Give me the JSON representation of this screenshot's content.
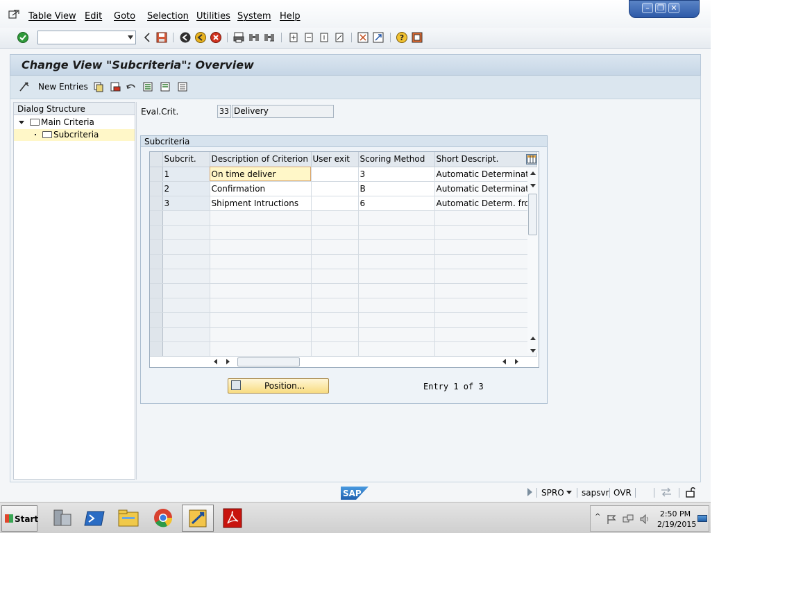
{
  "menu": {
    "items": [
      "Table View",
      "Edit",
      "Goto",
      "Selection",
      "Utilities",
      "System",
      "Help"
    ]
  },
  "window_controls": {
    "minimize": "–",
    "restore": "❐",
    "close": "✕"
  },
  "title": "Change View \"Subcriteria\": Overview",
  "app_toolbar": {
    "new_entries": "New Entries"
  },
  "dialog_structure": {
    "header": "Dialog Structure",
    "nodes": [
      "Main Criteria",
      "Subcriteria"
    ]
  },
  "eval_crit": {
    "label": "Eval.Crit.",
    "code": "33",
    "description": "Delivery"
  },
  "subcriteria": {
    "group_title": "Subcriteria",
    "columns": [
      "Subcrit.",
      "Description of Criterion",
      "User exit",
      "Scoring Method",
      "Short Descript."
    ],
    "rows": [
      {
        "subcrit": "1",
        "description": "On time deliver",
        "user_exit": "",
        "scoring_method": "3",
        "short_descript": "Automatic Determinatio"
      },
      {
        "subcrit": "2",
        "description": "Confirmation",
        "user_exit": "",
        "scoring_method": "B",
        "short_descript": "Automatic Determinatio"
      },
      {
        "subcrit": "3",
        "description": "Shipment Intructions",
        "user_exit": "",
        "scoring_method": "6",
        "short_descript": "Automatic Determ. fron"
      }
    ],
    "empty_rows": 10,
    "position_button": "Position...",
    "entry_info": "Entry 1 of 3"
  },
  "status_bar": {
    "transaction": "SPRO",
    "server": "sapsvr",
    "mode": "OVR",
    "logo": "SAP"
  },
  "taskbar": {
    "start": "Start",
    "apps": [
      "server-manager-icon",
      "powershell-icon",
      "explorer-icon",
      "chrome-icon",
      "sap-logon-icon",
      "acrobat-icon"
    ],
    "time": "2:50 PM",
    "date": "2/19/2015"
  },
  "colors": {
    "title_bg": "#c6d6e6",
    "focus_cell": "#fff7c8",
    "position_button": "#f8dc82",
    "window_blue": "#2e5aa8"
  }
}
